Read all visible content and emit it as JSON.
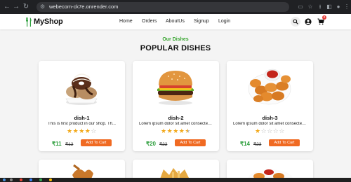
{
  "browser": {
    "url": "webecom-ck7e.onrender.com",
    "back_icon": "arrow-left-icon",
    "forward_icon": "arrow-right-icon",
    "reload_icon": "reload-icon"
  },
  "header": {
    "logo_text": "MyShop",
    "nav": [
      "Home",
      "Orders",
      "AboutUs",
      "Signup",
      "Login"
    ],
    "cart_count": "0"
  },
  "section": {
    "subtitle": "Our Dishes",
    "title": "POPULAR DISHES"
  },
  "cards": [
    {
      "name": "dish-1",
      "description": "This is first product in our shop. Th...",
      "rating": 4,
      "price": "₹11",
      "mrp": "₹12",
      "button": "Add To Cart"
    },
    {
      "name": "dish-2",
      "description": "Lorem ipsum dolor sit amet consectetu...",
      "rating": 4.5,
      "price": "₹20",
      "mrp": "₹22",
      "button": "Add To Cart"
    },
    {
      "name": "dish-3",
      "description": "Lorem ipsum dolor sit amet consectetu...",
      "rating": 1,
      "price": "₹14",
      "mrp": "₹23",
      "button": "Add To Cart"
    }
  ],
  "colors": {
    "accent_green": "#37a52f",
    "button_orange": "#f06a22",
    "star_gold": "#f2a818"
  }
}
